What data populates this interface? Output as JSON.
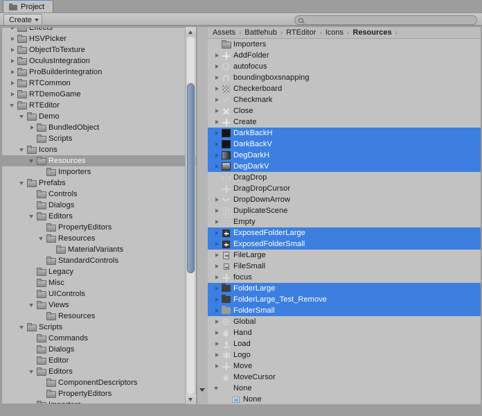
{
  "window": {
    "tab_label": "Project",
    "tab_icon": "folder-icon"
  },
  "toolbar": {
    "create_label": "Create",
    "create_caret_icon": "caret-down-icon",
    "search_placeholder": "",
    "search_value": "",
    "search_icon": "search-icon"
  },
  "breadcrumb": {
    "separator": "›",
    "items": [
      {
        "label": "Assets",
        "current": false
      },
      {
        "label": "Battlehub",
        "current": false
      },
      {
        "label": "RTEditor",
        "current": false
      },
      {
        "label": "Icons",
        "current": false
      },
      {
        "label": "Resources",
        "current": true
      }
    ]
  },
  "colors": {
    "selection_blue": "#3c7fe0",
    "selection_gray": "#9c9c9c",
    "panel_bg": "#c2c2c2",
    "window_bg": "#9d9d9d",
    "tab_accent": "#4a90d9"
  },
  "tree": {
    "clipped_top_item": "Effects",
    "items": [
      {
        "label": "Effects",
        "indent": 1,
        "arrow": "right",
        "icon": "folder-icon",
        "selected": false,
        "clipped": true
      },
      {
        "label": "HSVPicker",
        "indent": 1,
        "arrow": "right",
        "icon": "folder-icon",
        "selected": false
      },
      {
        "label": "ObjectToTexture",
        "indent": 1,
        "arrow": "right",
        "icon": "folder-icon",
        "selected": false
      },
      {
        "label": "OculusIntegration",
        "indent": 1,
        "arrow": "right",
        "icon": "folder-icon",
        "selected": false
      },
      {
        "label": "ProBuilderIntegration",
        "indent": 1,
        "arrow": "right",
        "icon": "folder-icon",
        "selected": false
      },
      {
        "label": "RTCommon",
        "indent": 1,
        "arrow": "right",
        "icon": "folder-icon",
        "selected": false
      },
      {
        "label": "RTDemoGame",
        "indent": 1,
        "arrow": "right",
        "icon": "folder-icon",
        "selected": false
      },
      {
        "label": "RTEditor",
        "indent": 1,
        "arrow": "down",
        "icon": "folder-icon",
        "selected": false
      },
      {
        "label": "Demo",
        "indent": 2,
        "arrow": "down",
        "icon": "folder-icon",
        "selected": false
      },
      {
        "label": "BundledObject",
        "indent": 3,
        "arrow": "right",
        "icon": "folder-icon",
        "selected": false
      },
      {
        "label": "Scripts",
        "indent": 3,
        "arrow": "none",
        "icon": "folder-icon",
        "selected": false
      },
      {
        "label": "Icons",
        "indent": 2,
        "arrow": "down",
        "icon": "folder-icon",
        "selected": false
      },
      {
        "label": "Resources",
        "indent": 3,
        "arrow": "down",
        "icon": "folder-icon",
        "selected": true
      },
      {
        "label": "Importers",
        "indent": 4,
        "arrow": "none",
        "icon": "folder-icon",
        "selected": false
      },
      {
        "label": "Prefabs",
        "indent": 2,
        "arrow": "down",
        "icon": "folder-icon",
        "selected": false
      },
      {
        "label": "Controls",
        "indent": 3,
        "arrow": "none",
        "icon": "folder-icon",
        "selected": false
      },
      {
        "label": "Dialogs",
        "indent": 3,
        "arrow": "none",
        "icon": "folder-icon",
        "selected": false
      },
      {
        "label": "Editors",
        "indent": 3,
        "arrow": "down",
        "icon": "folder-icon",
        "selected": false
      },
      {
        "label": "PropertyEditors",
        "indent": 4,
        "arrow": "none",
        "icon": "folder-icon",
        "selected": false
      },
      {
        "label": "Resources",
        "indent": 4,
        "arrow": "down",
        "icon": "folder-icon",
        "selected": false
      },
      {
        "label": "MaterialVariants",
        "indent": 5,
        "arrow": "none",
        "icon": "folder-icon",
        "selected": false
      },
      {
        "label": "StandardControls",
        "indent": 4,
        "arrow": "none",
        "icon": "folder-icon",
        "selected": false
      },
      {
        "label": "Legacy",
        "indent": 3,
        "arrow": "none",
        "icon": "folder-icon",
        "selected": false
      },
      {
        "label": "Misc",
        "indent": 3,
        "arrow": "none",
        "icon": "folder-icon",
        "selected": false
      },
      {
        "label": "UIControls",
        "indent": 3,
        "arrow": "none",
        "icon": "folder-icon",
        "selected": false
      },
      {
        "label": "Views",
        "indent": 3,
        "arrow": "down",
        "icon": "folder-icon",
        "selected": false
      },
      {
        "label": "Resources",
        "indent": 4,
        "arrow": "none",
        "icon": "folder-icon",
        "selected": false
      },
      {
        "label": "Scripts",
        "indent": 2,
        "arrow": "down",
        "icon": "folder-icon",
        "selected": false
      },
      {
        "label": "Commands",
        "indent": 3,
        "arrow": "none",
        "icon": "folder-icon",
        "selected": false
      },
      {
        "label": "Dialogs",
        "indent": 3,
        "arrow": "none",
        "icon": "folder-icon",
        "selected": false
      },
      {
        "label": "Editor",
        "indent": 3,
        "arrow": "none",
        "icon": "folder-icon",
        "selected": false
      },
      {
        "label": "Editors",
        "indent": 3,
        "arrow": "down",
        "icon": "folder-icon",
        "selected": false
      },
      {
        "label": "ComponentDescriptors",
        "indent": 4,
        "arrow": "none",
        "icon": "folder-icon",
        "selected": false
      },
      {
        "label": "PropertyEditors",
        "indent": 4,
        "arrow": "none",
        "icon": "folder-icon",
        "selected": false
      },
      {
        "label": "Importers",
        "indent": 3,
        "arrow": "none",
        "icon": "folder-icon",
        "selected": false
      }
    ]
  },
  "assets": {
    "items": [
      {
        "label": "Importers",
        "arrow": "none",
        "icon": "folder-icon",
        "selected": false
      },
      {
        "label": "AddFolder",
        "arrow": "right",
        "icon": "plus-icon",
        "selected": false
      },
      {
        "label": "autofocus",
        "arrow": "right",
        "icon": "circle-icon",
        "selected": false
      },
      {
        "label": "boundingboxsnapping",
        "arrow": "right",
        "icon": "magnet-icon",
        "selected": false
      },
      {
        "label": "Checkerboard",
        "arrow": "right",
        "icon": "checkerboard-icon",
        "selected": false
      },
      {
        "label": "Checkmark",
        "arrow": "right",
        "icon": "checkmark-icon",
        "selected": false
      },
      {
        "label": "Close",
        "arrow": "right",
        "icon": "close-x-icon",
        "selected": false
      },
      {
        "label": "Create",
        "arrow": "right",
        "icon": "plus-icon",
        "selected": false
      },
      {
        "label": "DarkBackH",
        "arrow": "right",
        "icon": "swatch-dark-icon",
        "selected": true
      },
      {
        "label": "DarkBackV",
        "arrow": "right",
        "icon": "swatch-dark-icon",
        "selected": true
      },
      {
        "label": "DegDarkH",
        "arrow": "right",
        "icon": "swatch-gradient-h-icon",
        "selected": true
      },
      {
        "label": "DegDarkV",
        "arrow": "right",
        "icon": "swatch-gradient-v-icon",
        "selected": true
      },
      {
        "label": "DragDrop",
        "arrow": "none",
        "icon": "cube-icon",
        "selected": false
      },
      {
        "label": "DragDropCursor",
        "arrow": "none",
        "icon": "move-cursor-icon",
        "selected": false
      },
      {
        "label": "DropDownArrow",
        "arrow": "right",
        "icon": "chevron-down-icon",
        "selected": false
      },
      {
        "label": "DuplicateScene",
        "arrow": "right",
        "icon": "duplicate-icon",
        "selected": false
      },
      {
        "label": "Empty",
        "arrow": "right",
        "icon": "blank-icon",
        "selected": false
      },
      {
        "label": "ExposedFolderLarge",
        "arrow": "right",
        "icon": "exposed-folder-icon",
        "selected": true
      },
      {
        "label": "ExposedFolderSmall",
        "arrow": "right",
        "icon": "exposed-folder-icon",
        "selected": true
      },
      {
        "label": "FileLarge",
        "arrow": "right",
        "icon": "file-icon",
        "selected": false
      },
      {
        "label": "FileSmall",
        "arrow": "right",
        "icon": "file-small-icon",
        "selected": false
      },
      {
        "label": "focus",
        "arrow": "right",
        "icon": "focus-icon",
        "selected": false
      },
      {
        "label": "FolderLarge",
        "arrow": "right",
        "icon": "folder-dark-icon",
        "selected": true
      },
      {
        "label": "FolderLarge_Test_Remove",
        "arrow": "right",
        "icon": "folder-dark-icon",
        "selected": true
      },
      {
        "label": "FolderSmall",
        "arrow": "right",
        "icon": "folder-light-icon",
        "selected": true
      },
      {
        "label": "Global",
        "arrow": "right",
        "icon": "globe-icon",
        "selected": false
      },
      {
        "label": "Hand",
        "arrow": "right",
        "icon": "hand-icon",
        "selected": false
      },
      {
        "label": "Load",
        "arrow": "right",
        "icon": "upload-icon",
        "selected": false
      },
      {
        "label": "Logo",
        "arrow": "right",
        "icon": "asterisk-icon",
        "selected": false
      },
      {
        "label": "Move",
        "arrow": "right",
        "icon": "move-icon",
        "selected": false
      },
      {
        "label": "MoveCursor",
        "arrow": "none",
        "icon": "hand-cursor-icon",
        "selected": false
      },
      {
        "label": "None",
        "arrow": "down",
        "icon": "blank-icon",
        "selected": false
      },
      {
        "label": "None",
        "arrow": "none",
        "icon": "sprite-icon",
        "selected": false,
        "child": true,
        "clipped": true
      }
    ]
  },
  "scrollbars": {
    "tree_vertical": {
      "thumb_top_pct": 13,
      "thumb_height_pct": 53
    },
    "list_down_arrow_icon": "caret-down-icon"
  }
}
